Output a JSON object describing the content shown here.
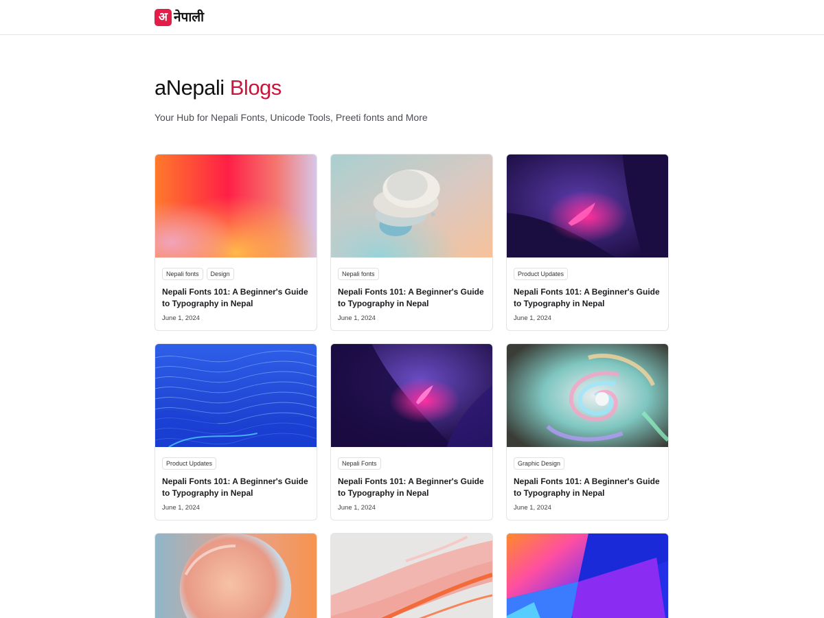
{
  "header": {
    "logo_mark": "अ",
    "logo_text": "नेपाली"
  },
  "hero": {
    "title_main": "aNepali",
    "title_accent": "Blogs",
    "subtitle": "Your Hub for Nepali Fonts, Unicode Tools, Preeti fonts and More"
  },
  "colors": {
    "accent": "#c8163d",
    "logo_bg": "#e11d48",
    "border": "#e4e4e7"
  },
  "posts": [
    {
      "tags": [
        "Nepali fonts",
        "Design"
      ],
      "title": "Nepali Fonts 101: A Beginner's Guide to Typography in Nepal",
      "date": "June 1, 2024"
    },
    {
      "tags": [
        "Nepali fonts"
      ],
      "title": "Nepali Fonts 101: A Beginner's Guide to Typography in Nepal",
      "date": "June 1, 2024"
    },
    {
      "tags": [
        "Product Updates"
      ],
      "title": "Nepali Fonts 101: A Beginner's Guide to Typography in Nepal",
      "date": "June 1, 2024"
    },
    {
      "tags": [
        "Product Updates"
      ],
      "title": "Nepali Fonts 101: A Beginner's Guide to Typography in Nepal",
      "date": "June 1, 2024"
    },
    {
      "tags": [
        "Nepali Fonts"
      ],
      "title": "Nepali Fonts 101: A Beginner's Guide to Typography in Nepal",
      "date": "June 1, 2024"
    },
    {
      "tags": [
        "Graphic Design"
      ],
      "title": "Nepali Fonts 101: A Beginner's Guide to Typography in Nepal",
      "date": "June 1, 2024"
    }
  ]
}
